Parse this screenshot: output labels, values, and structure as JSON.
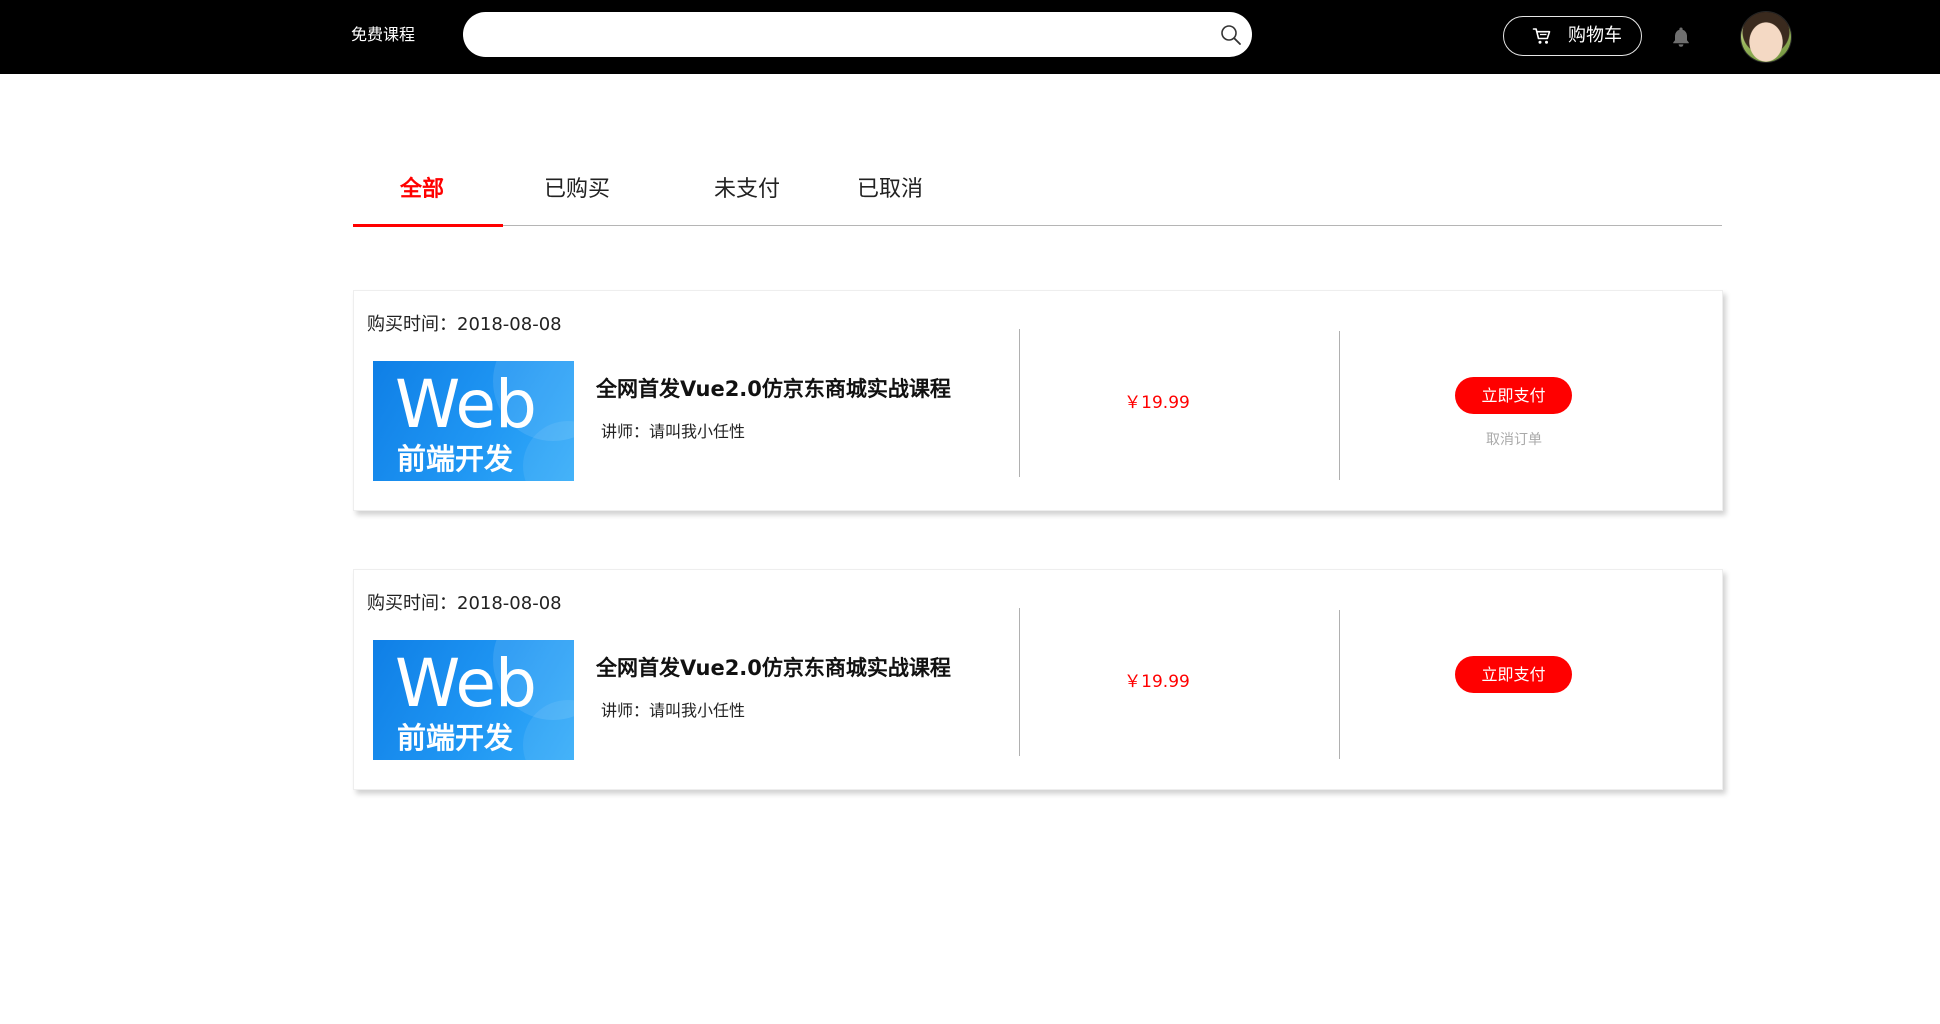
{
  "header": {
    "free_courses_label": "免费课程",
    "search": {
      "value": "",
      "placeholder": ""
    },
    "cart_label": "购物车"
  },
  "icons": {
    "search": "search-icon",
    "cart": "cart-icon",
    "bell": "bell-icon",
    "avatar": "user-avatar"
  },
  "tabs": [
    {
      "label": "全部",
      "active": true
    },
    {
      "label": "已购买",
      "active": false
    },
    {
      "label": "未支付",
      "active": false
    },
    {
      "label": "已取消",
      "active": false
    }
  ],
  "orders": [
    {
      "purchase_time_label": "购买时间：",
      "purchase_time": "2018-08-08",
      "thumbnail": {
        "big_text": "Web",
        "sub_text": "前端开发"
      },
      "title": "全网首发Vue2.0仿京东商城实战课程",
      "instructor_label": "讲师：",
      "instructor": "请叫我小任性",
      "price": "￥19.99",
      "pay_label": "立即支付",
      "cancel_label": "取消订单"
    },
    {
      "purchase_time_label": "购买时间：",
      "purchase_time": "2018-08-08",
      "thumbnail": {
        "big_text": "Web",
        "sub_text": "前端开发"
      },
      "title": "全网首发Vue2.0仿京东商城实战课程",
      "instructor_label": "讲师：",
      "instructor": "请叫我小任性",
      "price": "￥19.99",
      "pay_label": "立即支付"
    }
  ],
  "colors": {
    "header_bg": "#000000",
    "accent": "#ff0000",
    "thumbnail_blue": "#1f96f3",
    "muted_text": "#aaaaaa"
  }
}
